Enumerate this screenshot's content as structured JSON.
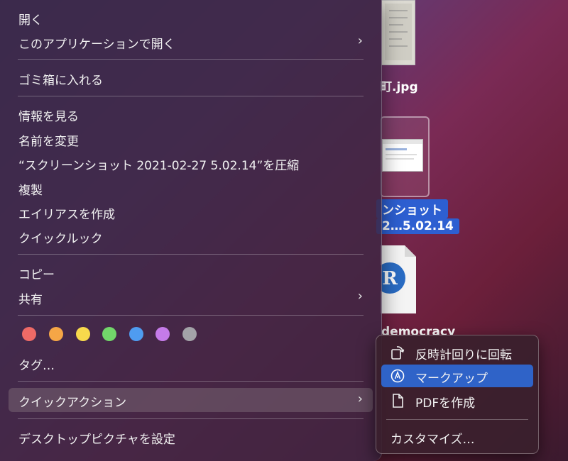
{
  "desktop": {
    "file1_label": "町.jpg",
    "file2_label_line1": "ンショット",
    "file2_label_line2": "2…5.02.14",
    "file3_label": "democracy",
    "r_icon_letter": "R"
  },
  "context_menu": {
    "open": "開く",
    "open_with": "このアプリケーションで開く",
    "move_to_trash": "ゴミ箱に入れる",
    "get_info": "情報を見る",
    "rename": "名前を変更",
    "compress": "“スクリーンショット 2021-02-27 5.02.14”を圧縮",
    "duplicate": "複製",
    "make_alias": "エイリアスを作成",
    "quick_look": "クイックルック",
    "copy": "コピー",
    "share": "共有",
    "tags": "タグ…",
    "quick_actions": "クイックアクション",
    "set_desktop_picture": "デスクトップピクチャを設定",
    "chevron": "›",
    "tag_colors": [
      "#ee6a66",
      "#f5a646",
      "#f7d94c",
      "#72d66a",
      "#4f9cf0",
      "#c57be9",
      "#a3a3a8"
    ]
  },
  "quick_actions_submenu": {
    "rotate_left": "反時計回りに回転",
    "markup": "マークアップ",
    "create_pdf": "PDFを作成",
    "customize": "カスタマイズ…"
  },
  "colors": {
    "highlight": "#2f63c8",
    "selection_label": "#2d5fd1"
  }
}
